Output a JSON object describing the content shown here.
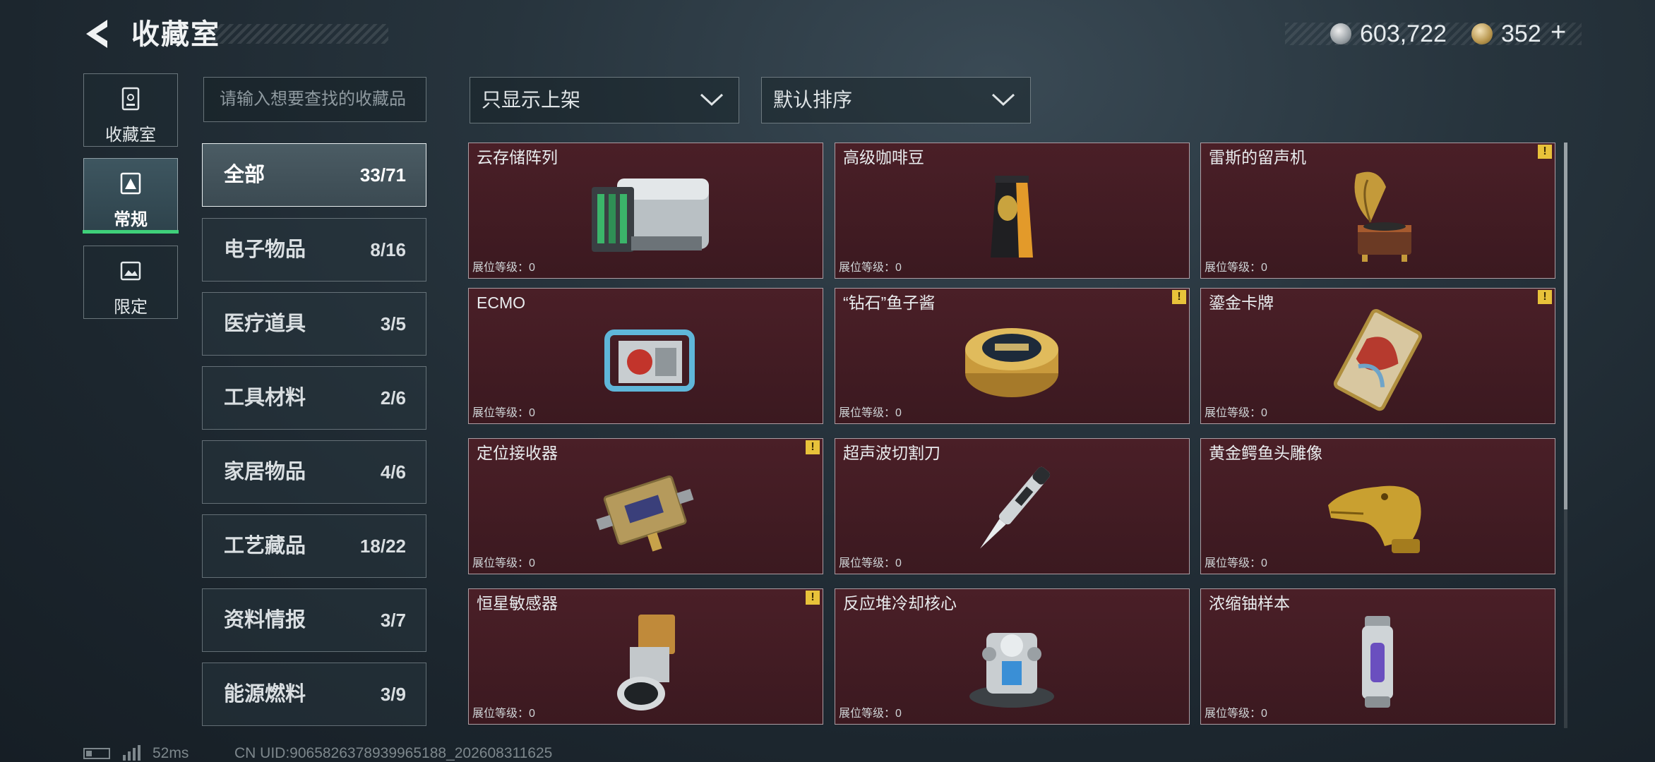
{
  "header": {
    "title": "收藏室",
    "currency_silver": "603,722",
    "currency_gold": "352",
    "add_symbol": "+"
  },
  "left_tabs": [
    {
      "label": "收藏室",
      "icon": "vault-icon"
    },
    {
      "label": "常规",
      "icon": "collection-icon",
      "active": true
    },
    {
      "label": "限定",
      "icon": "picture-icon"
    }
  ],
  "search": {
    "placeholder": "请输入想要查找的收藏品"
  },
  "filters": {
    "display_filter": "只显示上架",
    "sort_order": "默认排序"
  },
  "categories": [
    {
      "name": "全部",
      "count": "33/71",
      "active": true
    },
    {
      "name": "电子物品",
      "count": "8/16"
    },
    {
      "name": "医疗道具",
      "count": "3/5"
    },
    {
      "name": "工具材料",
      "count": "2/6"
    },
    {
      "name": "家居物品",
      "count": "4/6"
    },
    {
      "name": "工艺藏品",
      "count": "18/22"
    },
    {
      "name": "资料情报",
      "count": "3/7"
    },
    {
      "name": "能源燃料",
      "count": "3/9"
    }
  ],
  "items": [
    {
      "name": "云存储阵列",
      "level": "展位等级：0",
      "alert": false,
      "icon": "server-array-icon"
    },
    {
      "name": "高级咖啡豆",
      "level": "展位等级：0",
      "alert": false,
      "icon": "coffee-bag-icon"
    },
    {
      "name": "雷斯的留声机",
      "level": "展位等级：0",
      "alert": true,
      "icon": "gramophone-icon"
    },
    {
      "name": "ECMO",
      "level": "展位等级：0",
      "alert": false,
      "icon": "ecmo-machine-icon"
    },
    {
      "name": "“钻石”鱼子酱",
      "level": "展位等级：0",
      "alert": true,
      "icon": "caviar-tin-icon"
    },
    {
      "name": "鎏金卡牌",
      "level": "展位等级：0",
      "alert": true,
      "icon": "gilded-card-icon"
    },
    {
      "name": "定位接收器",
      "level": "展位等级：0",
      "alert": true,
      "icon": "receiver-icon"
    },
    {
      "name": "超声波切割刀",
      "level": "展位等级：0",
      "alert": false,
      "icon": "ultrasonic-knife-icon"
    },
    {
      "name": "黄金鳄鱼头雕像",
      "level": "展位等级：0",
      "alert": false,
      "icon": "crocodile-statue-icon"
    },
    {
      "name": "恒星敏感器",
      "level": "展位等级：0",
      "alert": true,
      "icon": "star-sensor-icon"
    },
    {
      "name": "反应堆冷却核心",
      "level": "展位等级：0",
      "alert": false,
      "icon": "reactor-core-icon"
    },
    {
      "name": "浓缩铀样本",
      "level": "展位等级：0",
      "alert": false,
      "icon": "uranium-capsule-icon"
    }
  ],
  "alert_symbol": "!",
  "footer": {
    "ping": "52ms",
    "uid": "CN UID:9065826378939965188_202608311625"
  },
  "colors": {
    "card_bg": "#3f1b22",
    "active_tab_bar": "#3fd07a",
    "alert": "#e8c23a"
  }
}
